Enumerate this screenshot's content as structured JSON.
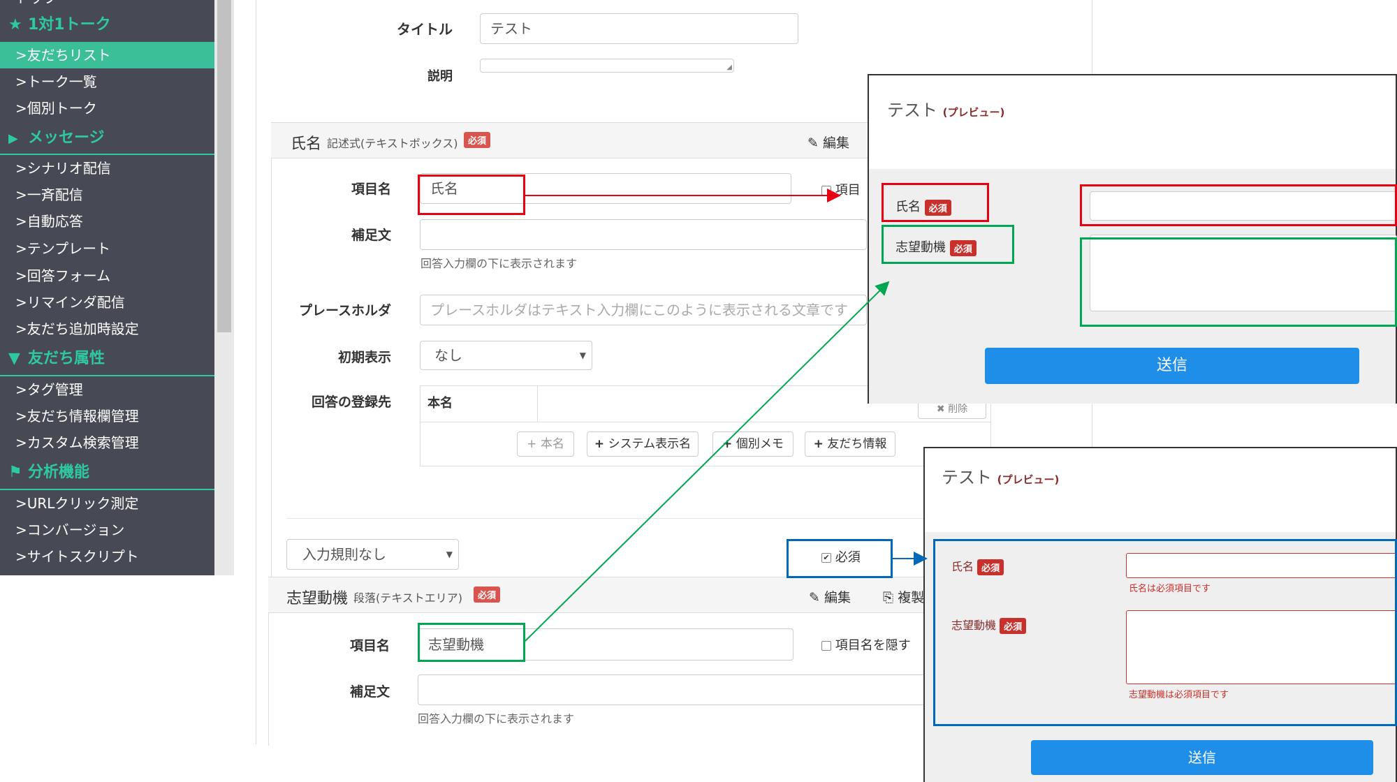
{
  "sidebar": {
    "top_partial": "トップ",
    "sections": [
      {
        "title": "1対1トーク",
        "icon": "star-icon",
        "glyph": "★"
      },
      {
        "title": "メッセージ",
        "icon": "megaphone-icon",
        "glyph": "📢"
      },
      {
        "title": "友だち属性",
        "icon": "filter-icon",
        "glyph": "▼"
      },
      {
        "title": "分析機能",
        "icon": "flag-icon",
        "glyph": "⚑"
      }
    ],
    "items": [
      ">友だちリスト",
      ">トーク一覧",
      ">個別トーク",
      ">シナリオ配信",
      ">一斉配信",
      ">自動応答",
      ">テンプレート",
      ">回答フォーム",
      ">リマインダ配信",
      ">友だち追加時設定",
      ">タグ管理",
      ">友だち情報欄管理",
      ">カスタム検索管理",
      ">URLクリック測定",
      ">コンバージョン",
      ">サイトスクリプト"
    ],
    "active_index": 0,
    "accent_color": "#2fc9a0"
  },
  "form": {
    "title_label": "タイトル",
    "title_value": "テスト",
    "desc_label": "説明",
    "field1": {
      "name": "氏名",
      "type": "記述式(テキストボックス)",
      "required_badge": "必須",
      "edit_label": "編集",
      "item_name_label": "項目名",
      "item_name_value": "氏名",
      "hide_label_partial": "項目",
      "supplement_label": "補足文",
      "supplement_hint": "回答入力欄の下に表示されます",
      "placeholder_label": "プレースホルダ",
      "placeholder_text": "プレースホルダはテキスト入力欄にこのように表示される文章です",
      "initial_label": "初期表示",
      "initial_value": "なし",
      "register_label": "回答の登録先",
      "register_value": "本名",
      "delete_label": "削除",
      "add_buttons": [
        "本名",
        "システム表示名",
        "個別メモ",
        "友だち情報"
      ],
      "rule_value": "入力規則なし",
      "required_check_label": "必須"
    },
    "field2": {
      "name": "志望動機",
      "type": "段落(テキストエリア)",
      "required_badge": "必須",
      "edit_label": "編集",
      "copy_label": "複製",
      "item_name_label": "項目名",
      "item_name_value": "志望動機",
      "hide_label": "項目名を隠す",
      "supplement_label": "補足文",
      "supplement_hint": "回答入力欄の下に表示されます"
    }
  },
  "preview1": {
    "title": "テスト",
    "subtitle": "(プレビュー)",
    "field1_label": "氏名",
    "field2_label": "志望動機",
    "required_badge": "必須",
    "submit_label": "送信"
  },
  "preview2": {
    "title": "テスト",
    "subtitle": "(プレビュー)",
    "field1_label": "氏名",
    "field1_error": "氏名は必須項目です",
    "field2_label": "志望動機",
    "field2_error": "志望動機は必須項目です",
    "required_badge": "必須",
    "submit_label": "送信"
  },
  "colors": {
    "highlight_red": "#e60012",
    "highlight_green": "#00a651",
    "highlight_blue": "#0068b7",
    "submit_blue": "#1f8ee8"
  }
}
